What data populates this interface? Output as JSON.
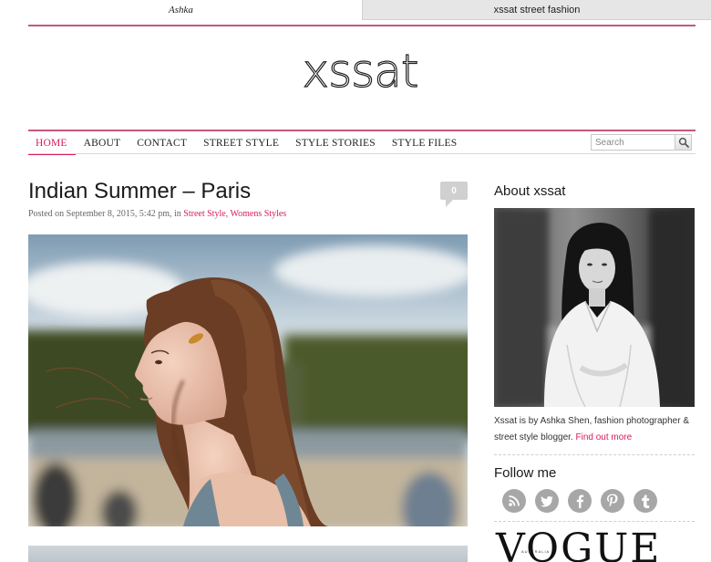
{
  "tabs": [
    {
      "label": "Ashka"
    },
    {
      "label": "xssat street fashion"
    }
  ],
  "site": {
    "logo": "xssat"
  },
  "nav": {
    "items": [
      "HOME",
      "ABOUT",
      "CONTACT",
      "STREET STYLE",
      "STYLE STORIES",
      "STYLE FILES"
    ],
    "active": "HOME"
  },
  "search": {
    "placeholder": "Search",
    "icon": "magnifier-icon"
  },
  "post": {
    "title": "Indian Summer – Paris",
    "meta_prefix": "Posted on September 8, 2015, 5:42 pm, in",
    "categories": [
      "Street Style",
      "Womens Styles"
    ],
    "comment_count": "0"
  },
  "sidebar": {
    "about_heading": "About xssat",
    "about_text": "Xssat is by Ashka Shen, fashion photographer & street style blogger.",
    "about_link": "Find out more",
    "follow_heading": "Follow me",
    "social": [
      "rss-icon",
      "twitter-icon",
      "facebook-icon",
      "pinterest-icon",
      "tumblr-icon"
    ],
    "press_logo": "VOGUE",
    "press_sub": "AUSTRALIA"
  },
  "colors": {
    "accent": "#d91a5c",
    "rule": "#c6587b",
    "icon_bg": "#a7a7a7"
  }
}
